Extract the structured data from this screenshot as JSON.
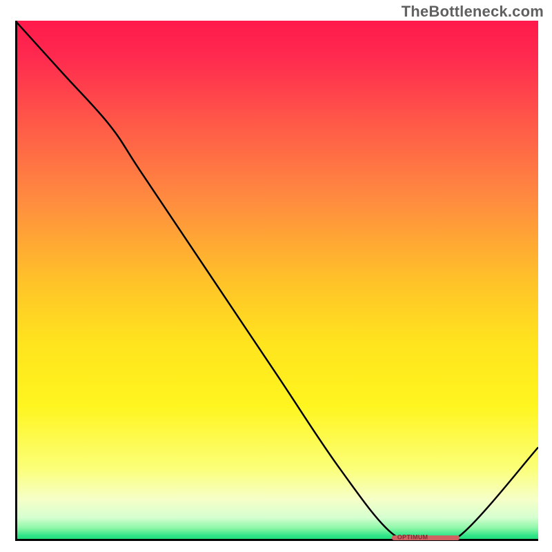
{
  "attribution": "TheBottleneck.com",
  "chart_data": {
    "type": "line",
    "title": "",
    "xlabel": "",
    "ylabel": "",
    "xlim": [
      0,
      100
    ],
    "ylim": [
      0,
      100
    ],
    "annotation_text": "OPTIMUM",
    "curve": [
      {
        "x": 0,
        "y": 100
      },
      {
        "x": 9,
        "y": 90
      },
      {
        "x": 18,
        "y": 80
      },
      {
        "x": 24,
        "y": 71
      },
      {
        "x": 36,
        "y": 53
      },
      {
        "x": 50,
        "y": 32
      },
      {
        "x": 62,
        "y": 14
      },
      {
        "x": 72,
        "y": 1.5
      },
      {
        "x": 78,
        "y": 0.6
      },
      {
        "x": 85,
        "y": 1.0
      },
      {
        "x": 100,
        "y": 18
      }
    ],
    "optimum_band": {
      "x_start": 72,
      "x_end": 85,
      "y": 0.6
    },
    "background_gradient": [
      {
        "offset": 0.0,
        "color": "#ff1a4b"
      },
      {
        "offset": 0.07,
        "color": "#ff2a4f"
      },
      {
        "offset": 0.2,
        "color": "#ff5a48"
      },
      {
        "offset": 0.34,
        "color": "#ff8a40"
      },
      {
        "offset": 0.5,
        "color": "#ffc229"
      },
      {
        "offset": 0.62,
        "color": "#ffe41e"
      },
      {
        "offset": 0.74,
        "color": "#fff51f"
      },
      {
        "offset": 0.86,
        "color": "#fbff78"
      },
      {
        "offset": 0.92,
        "color": "#f6ffc8"
      },
      {
        "offset": 0.955,
        "color": "#d6ffd0"
      },
      {
        "offset": 0.975,
        "color": "#8ef7a8"
      },
      {
        "offset": 0.99,
        "color": "#2fe487"
      },
      {
        "offset": 1.0,
        "color": "#17d977"
      }
    ],
    "axis_color": "#000000",
    "curve_color": "#000000"
  }
}
